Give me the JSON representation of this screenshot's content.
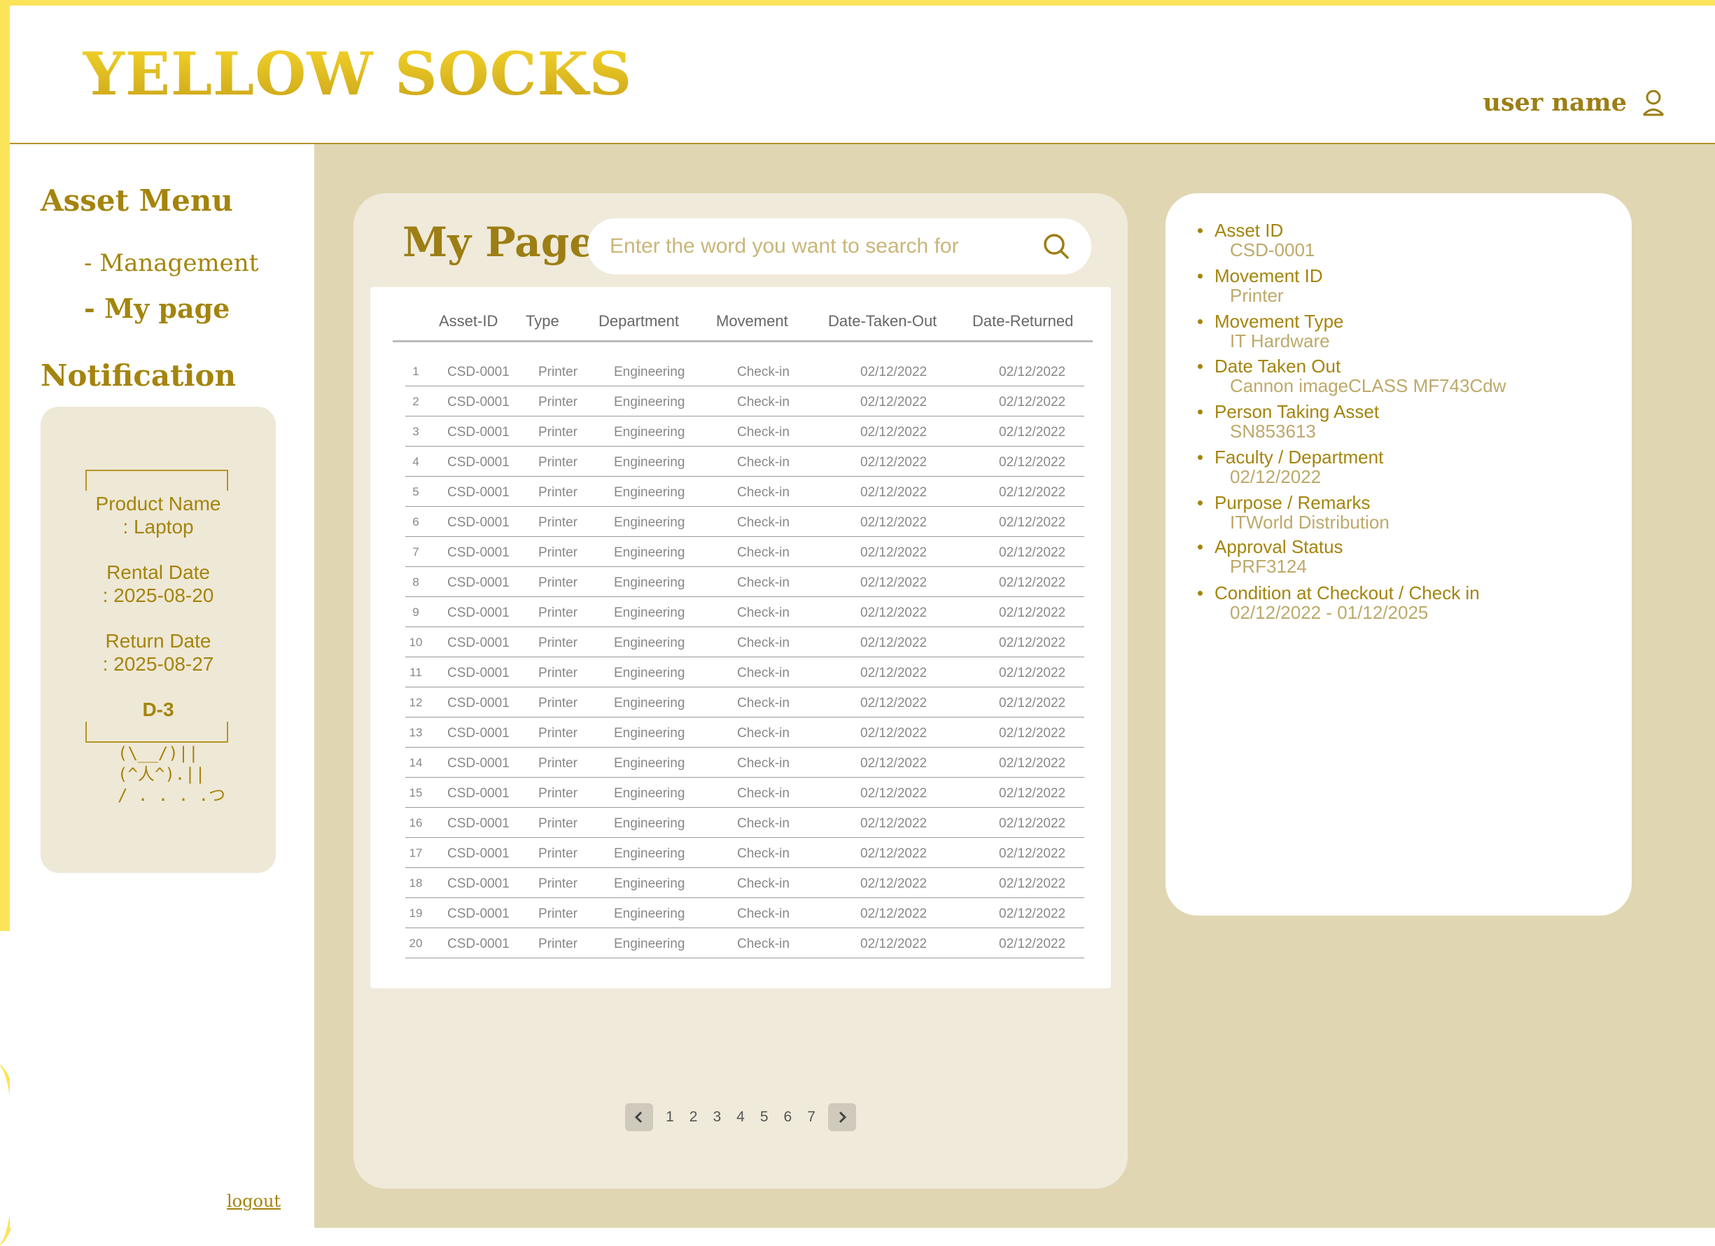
{
  "brand": {
    "name": "YELLOW SOCKS"
  },
  "header": {
    "user_name": "user name"
  },
  "sidebar": {
    "asset_menu_title": "Asset Menu",
    "items": [
      {
        "label": "- Management"
      },
      {
        "label": "- My page"
      }
    ],
    "notification_title": "Notification",
    "logout": "logout"
  },
  "notification": {
    "product_line1": "Product Name",
    "product_line2": ": Laptop",
    "rental_line1": "Rental Date",
    "rental_line2": ": 2025-08-20",
    "return_line1": "Return Date",
    "return_line2": ": 2025-08-27",
    "dday": "D-3",
    "ascii_art": "(\\__/)||\n(^人^).||\n/ . . . .つ"
  },
  "main": {
    "title": "My Page",
    "search": {
      "placeholder": "Enter the word you want to search for",
      "value": ""
    }
  },
  "table": {
    "columns": [
      "Asset-ID",
      "Type",
      "Department",
      "Movement",
      "Date-Taken-Out",
      "Date-Returned"
    ],
    "rows": [
      [
        "1",
        "CSD-0001",
        "Printer",
        "Engineering",
        "Check-in",
        "02/12/2022",
        "02/12/2022"
      ],
      [
        "2",
        "CSD-0001",
        "Printer",
        "Engineering",
        "Check-in",
        "02/12/2022",
        "02/12/2022"
      ],
      [
        "3",
        "CSD-0001",
        "Printer",
        "Engineering",
        "Check-in",
        "02/12/2022",
        "02/12/2022"
      ],
      [
        "4",
        "CSD-0001",
        "Printer",
        "Engineering",
        "Check-in",
        "02/12/2022",
        "02/12/2022"
      ],
      [
        "5",
        "CSD-0001",
        "Printer",
        "Engineering",
        "Check-in",
        "02/12/2022",
        "02/12/2022"
      ],
      [
        "6",
        "CSD-0001",
        "Printer",
        "Engineering",
        "Check-in",
        "02/12/2022",
        "02/12/2022"
      ],
      [
        "7",
        "CSD-0001",
        "Printer",
        "Engineering",
        "Check-in",
        "02/12/2022",
        "02/12/2022"
      ],
      [
        "8",
        "CSD-0001",
        "Printer",
        "Engineering",
        "Check-in",
        "02/12/2022",
        "02/12/2022"
      ],
      [
        "9",
        "CSD-0001",
        "Printer",
        "Engineering",
        "Check-in",
        "02/12/2022",
        "02/12/2022"
      ],
      [
        "10",
        "CSD-0001",
        "Printer",
        "Engineering",
        "Check-in",
        "02/12/2022",
        "02/12/2022"
      ],
      [
        "11",
        "CSD-0001",
        "Printer",
        "Engineering",
        "Check-in",
        "02/12/2022",
        "02/12/2022"
      ],
      [
        "12",
        "CSD-0001",
        "Printer",
        "Engineering",
        "Check-in",
        "02/12/2022",
        "02/12/2022"
      ],
      [
        "13",
        "CSD-0001",
        "Printer",
        "Engineering",
        "Check-in",
        "02/12/2022",
        "02/12/2022"
      ],
      [
        "14",
        "CSD-0001",
        "Printer",
        "Engineering",
        "Check-in",
        "02/12/2022",
        "02/12/2022"
      ],
      [
        "15",
        "CSD-0001",
        "Printer",
        "Engineering",
        "Check-in",
        "02/12/2022",
        "02/12/2022"
      ],
      [
        "16",
        "CSD-0001",
        "Printer",
        "Engineering",
        "Check-in",
        "02/12/2022",
        "02/12/2022"
      ],
      [
        "17",
        "CSD-0001",
        "Printer",
        "Engineering",
        "Check-in",
        "02/12/2022",
        "02/12/2022"
      ],
      [
        "18",
        "CSD-0001",
        "Printer",
        "Engineering",
        "Check-in",
        "02/12/2022",
        "02/12/2022"
      ],
      [
        "19",
        "CSD-0001",
        "Printer",
        "Engineering",
        "Check-in",
        "02/12/2022",
        "02/12/2022"
      ],
      [
        "20",
        "CSD-0001",
        "Printer",
        "Engineering",
        "Check-in",
        "02/12/2022",
        "02/12/2022"
      ]
    ]
  },
  "pagination": {
    "pages": [
      "1",
      "2",
      "3",
      "4",
      "5",
      "6",
      "7"
    ]
  },
  "details": [
    {
      "label": "Asset ID",
      "value": "CSD-0001"
    },
    {
      "label": "Movement ID",
      "value": "Printer"
    },
    {
      "label": "Movement Type",
      "value": "IT Hardware"
    },
    {
      "label": "Date Taken Out",
      "value": "Cannon imageCLASS MF743Cdw"
    },
    {
      "label": "Person Taking Asset",
      "value": "SN853613"
    },
    {
      "label": "Faculty / Department",
      "value": "02/12/2022"
    },
    {
      "label": "Purpose / Remarks",
      "value": "ITWorld Distribution"
    },
    {
      "label": "Approval Status",
      "value": "PRF3124"
    },
    {
      "label": "Condition at Checkout / Check in",
      "value": "02/12/2022 - 01/12/2025"
    }
  ],
  "colors": {
    "brand_yellow": "#fbe45a",
    "gold_text": "#a4840c",
    "main_background": "#e0d6b2",
    "panel_background": "#f0eadb"
  },
  "icons": {
    "user": "user-icon",
    "search": "search-icon",
    "prev": "chevron-left-icon",
    "next": "chevron-right-icon"
  }
}
